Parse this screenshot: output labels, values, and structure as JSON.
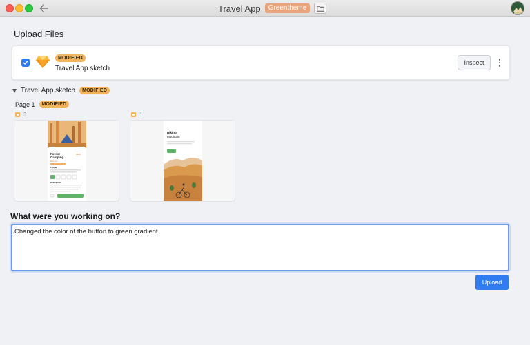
{
  "window": {
    "title": "Travel App",
    "theme_tag": "Greentheme"
  },
  "page": {
    "heading": "Upload Files"
  },
  "file": {
    "status_badge": "MODIFIED",
    "name": "Travel App.sketch",
    "inspect_label": "Inspect",
    "checked": true
  },
  "tree": {
    "document_name": "Travel App.sketch",
    "document_badge": "MODIFIED",
    "page_name": "Page 1",
    "page_badge": "MODIFIED"
  },
  "artboards": [
    {
      "count": "3",
      "preview_texts": [
        "Forest",
        "Camping",
        "$220",
        "Mountain",
        "People",
        "Description"
      ]
    },
    {
      "count": "1",
      "preview_texts": [
        "Biking",
        "Mountain"
      ]
    }
  ],
  "form": {
    "question": "What were you working on?",
    "comment_value": "Changed the color of the button to green gradient.",
    "upload_label": "Upload"
  },
  "colors": {
    "accent": "#2f7bf0",
    "badge": "#f1b45c",
    "theme_tag": "#e9a47c",
    "focus_border": "#6f9be8",
    "preview_green": "#5fb46a",
    "preview_orange": "#d99a4e"
  },
  "icons": {
    "back": "arrow-left-icon",
    "folder": "folder-icon",
    "sketch": "sketch-diamond-icon",
    "more": "vertical-ellipsis-icon",
    "disclosure": "triangle-down-icon",
    "artboard": "artboard-icon"
  }
}
